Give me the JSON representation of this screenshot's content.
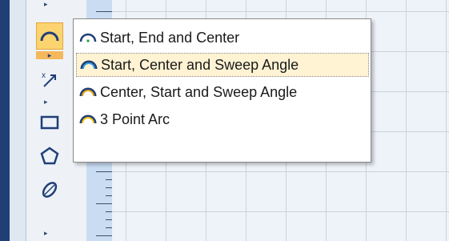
{
  "toolbar": {
    "tools": [
      {
        "name": "arc-tool",
        "icon": "arc-icon",
        "selected": true
      },
      {
        "name": "dimension-tool",
        "icon": "dimension-icon"
      },
      {
        "name": "rectangle-tool",
        "icon": "rectangle-icon"
      },
      {
        "name": "polygon-tool",
        "icon": "pentagon-icon"
      },
      {
        "name": "ellipse-tool",
        "icon": "ellipse-icon"
      }
    ]
  },
  "arc_menu": {
    "items": [
      {
        "label": "Start, End and Center",
        "icon": "arc-start-end-center-icon"
      },
      {
        "label": "Start, Center and Sweep Angle",
        "icon": "arc-start-center-sweep-icon",
        "highlighted": true
      },
      {
        "label": "Center, Start and Sweep Angle",
        "icon": "arc-center-start-sweep-icon"
      },
      {
        "label": "3 Point Arc",
        "icon": "arc-three-point-icon"
      }
    ]
  },
  "colors": {
    "accent_selected": "#fbd36f",
    "hover_bg": "#fff3d4",
    "canvas_bg": "#eef3f9",
    "grid_line": "#c9d3de"
  }
}
